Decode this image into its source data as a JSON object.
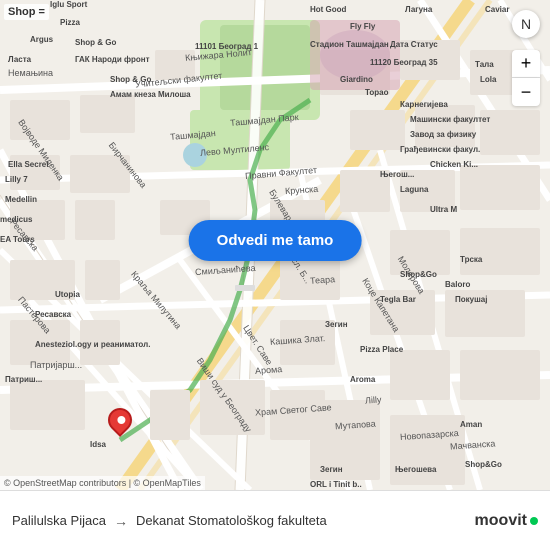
{
  "map": {
    "background_color": "#f2efe9",
    "navigate_button_label": "Odvedi me tamo",
    "attribution": "© OpenStreetMap contributors | © OpenMapTiles",
    "shop_label": "Shop =",
    "compass_symbol": "N"
  },
  "bottom_bar": {
    "from": "Palilulska Pijaca",
    "arrow": "→",
    "to": "Dekanat Stomatološkog fakulteta",
    "logo_text": "moovit"
  },
  "controls": {
    "zoom_in": "+",
    "zoom_out": "−"
  }
}
